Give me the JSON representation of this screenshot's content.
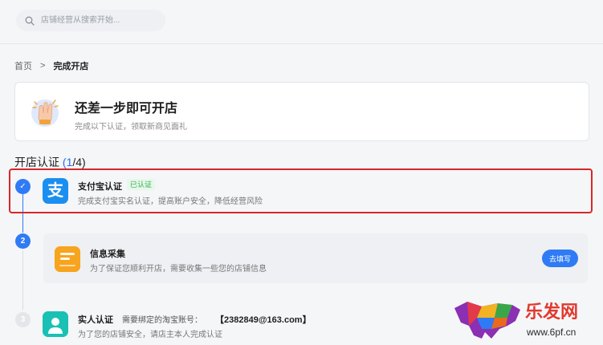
{
  "search": {
    "placeholder": "店铺经营从搜索开始..."
  },
  "breadcrumb": {
    "home": "首页",
    "separator": ">",
    "current": "完成开店"
  },
  "banner": {
    "title": "还差一步即可开店",
    "subtitle": "完成以下认证，领取新商见面礼"
  },
  "section": {
    "title": "开店认证",
    "progress": "1",
    "total": "/4)",
    "open": "("
  },
  "steps": [
    {
      "number": "✓",
      "title": "支付宝认证",
      "badge": "已认证",
      "desc": "完成支付宝实名认证，提高账户安全，降低经营风险",
      "icon": "alipay-icon",
      "icon_char": "支"
    },
    {
      "number": "2",
      "title": "信息采集",
      "desc": "为了保证您顺利开店，需要收集一些您的店铺信息",
      "button": "去填写",
      "icon": "info-form-icon"
    },
    {
      "number": "3",
      "title": "实人认证",
      "extra": "需要绑定的淘宝账号：",
      "account": "【2382849@163.com】",
      "desc": "为了您的店铺安全，请店主本人完成认证",
      "icon": "person-icon"
    }
  ],
  "watermark": {
    "brand": "乐发网",
    "url": "www.6pf.cn"
  },
  "colors": {
    "primary": "#2f7bf5",
    "highlight": "#d7262a",
    "badge_green": "#2fb14a",
    "alipay": "#1a8ff0",
    "info": "#f7a41e",
    "person": "#19c1b5"
  }
}
